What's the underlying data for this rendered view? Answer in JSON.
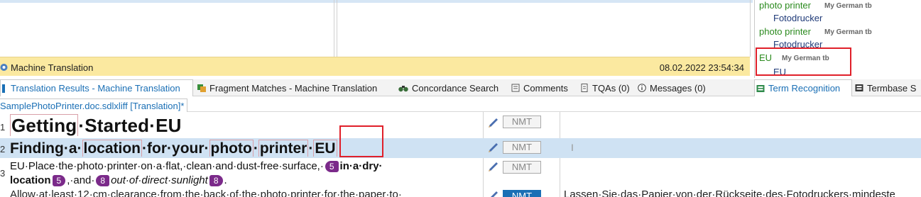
{
  "mt_bar": {
    "label": "Machine Translation",
    "date": "08.02.2022 23:54:34"
  },
  "term_recognition": {
    "entries": [
      {
        "source": "photo printer",
        "termbase": "My German tb",
        "target": "Fotodrucker"
      },
      {
        "source": "photo printer",
        "termbase": "My German tb",
        "target": "Fotodrucker"
      },
      {
        "source": "EU",
        "termbase": "My German tb",
        "target": "EU"
      }
    ]
  },
  "tabs": [
    {
      "label": "Translation Results - Machine Translation",
      "icon": "translation-results-icon"
    },
    {
      "label": "Fragment Matches - Machine Translation",
      "icon": "fragment-matches-icon"
    },
    {
      "label": "Concordance Search",
      "icon": "binoculars-icon"
    },
    {
      "label": "Comments",
      "icon": "comments-icon"
    },
    {
      "label": "TQAs (0)",
      "icon": "tqa-icon"
    },
    {
      "label": "Messages (0)",
      "icon": "info-icon"
    },
    {
      "label": "Term Recognition",
      "icon": "term-recognition-icon"
    },
    {
      "label": "Termbase S",
      "icon": "termbase-search-icon"
    }
  ],
  "document_tab": {
    "label": "SamplePhotoPrinter.doc.sdlxliff [Translation]*"
  },
  "segments": [
    {
      "num": "1",
      "src": {
        "w1": "Getting",
        "w2": "Started",
        "w3": "EU"
      },
      "status": "NMT",
      "target": ""
    },
    {
      "num": "2",
      "src": {
        "w1": "Finding",
        "w2": "a",
        "w3": "location",
        "w4": "for",
        "w5": "your",
        "w6": "photo",
        "w7": "printer",
        "w8": "EU"
      },
      "status": "NMT",
      "target": ""
    },
    {
      "num": "3",
      "src": {
        "p1": "EU·Place·the·photo·printer·on·a·flat,·clean·and·dust-free·surface,·",
        "t5": "5",
        "b1": "in·a·dry·",
        "b2": "location",
        "t5c": "5",
        "p2": ",·and·",
        "t8": "8",
        "i1": "out·of·direct·sunlight",
        "t8c": "8",
        "p3": "."
      },
      "status": "NMT",
      "target": ""
    },
    {
      "num": "",
      "src": {
        "p1": "Allow·at·least·12·cm·clearance·from·the·back·of·the·photo·printer·for·the·paper·to·"
      },
      "status": "NMT",
      "target": "Lassen·Sie·das·Papier·von·der·Rückseite·des·Fotodruckers·mindeste"
    }
  ],
  "colors": {
    "accent": "#1a6fb5",
    "mt_bar": "#fbe9a0",
    "tag": "#7b2a8a",
    "highlight": "#e0202a",
    "term_source": "#2b8a1e"
  }
}
